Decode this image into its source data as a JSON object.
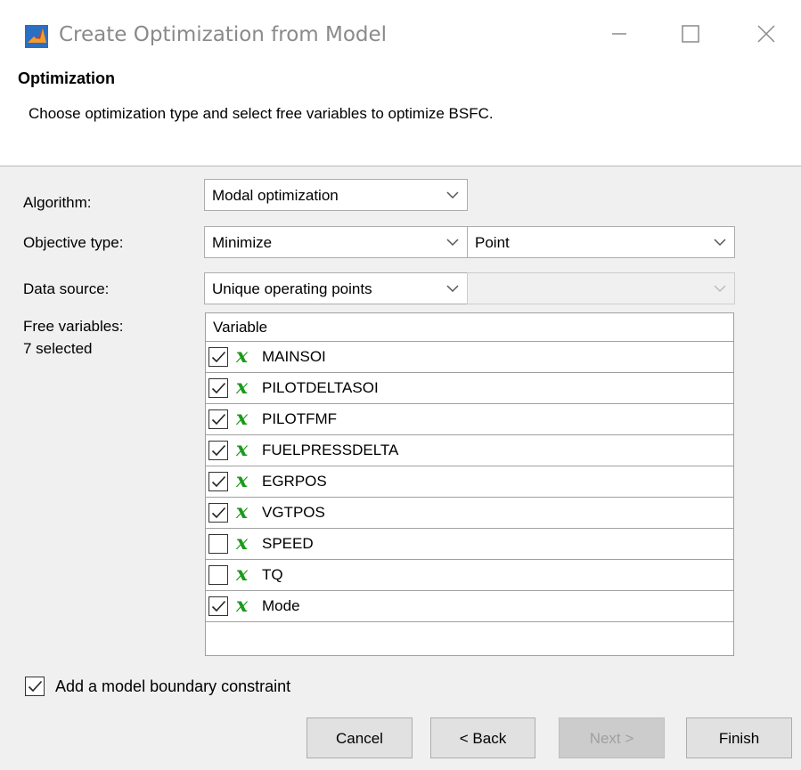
{
  "window": {
    "title": "Create Optimization from Model"
  },
  "header": {
    "title": "Optimization",
    "description": "Choose optimization type and select free variables to optimize BSFC."
  },
  "form": {
    "algorithm_label": "Algorithm:",
    "algorithm_value": "Modal optimization",
    "objective_label": "Objective type:",
    "objective_value": "Minimize",
    "objective_scope_value": "Point",
    "datasource_label": "Data source:",
    "datasource_value": "Unique operating points",
    "datasource_secondary_value": "",
    "free_vars_label": "Free variables:",
    "free_vars_count": "7 selected"
  },
  "table": {
    "header": "Variable",
    "rows": [
      {
        "name": "MAINSOI",
        "checked": true,
        "icon": "variable-x-icon"
      },
      {
        "name": "PILOTDELTASOI",
        "checked": true,
        "icon": "variable-x-icon"
      },
      {
        "name": "PILOTFMF",
        "checked": true,
        "icon": "variable-x-icon"
      },
      {
        "name": "FUELPRESSDELTA",
        "checked": true,
        "icon": "variable-x-icon"
      },
      {
        "name": "EGRPOS",
        "checked": true,
        "icon": "variable-x-icon"
      },
      {
        "name": "VGTPOS",
        "checked": true,
        "icon": "variable-x-icon"
      },
      {
        "name": "SPEED",
        "checked": false,
        "icon": "variable-x-icon"
      },
      {
        "name": "TQ",
        "checked": false,
        "icon": "variable-x-icon"
      },
      {
        "name": "Mode",
        "checked": true,
        "icon": "variable-x-icon"
      }
    ],
    "variable_glyph": "x"
  },
  "boundary": {
    "label": "Add a model boundary constraint",
    "checked": true
  },
  "buttons": {
    "cancel": "Cancel",
    "back": "< Back",
    "next": "Next >",
    "finish": "Finish"
  },
  "colors": {
    "variable_icon": "#1a9a1a",
    "title_text": "#8a8a8a"
  }
}
